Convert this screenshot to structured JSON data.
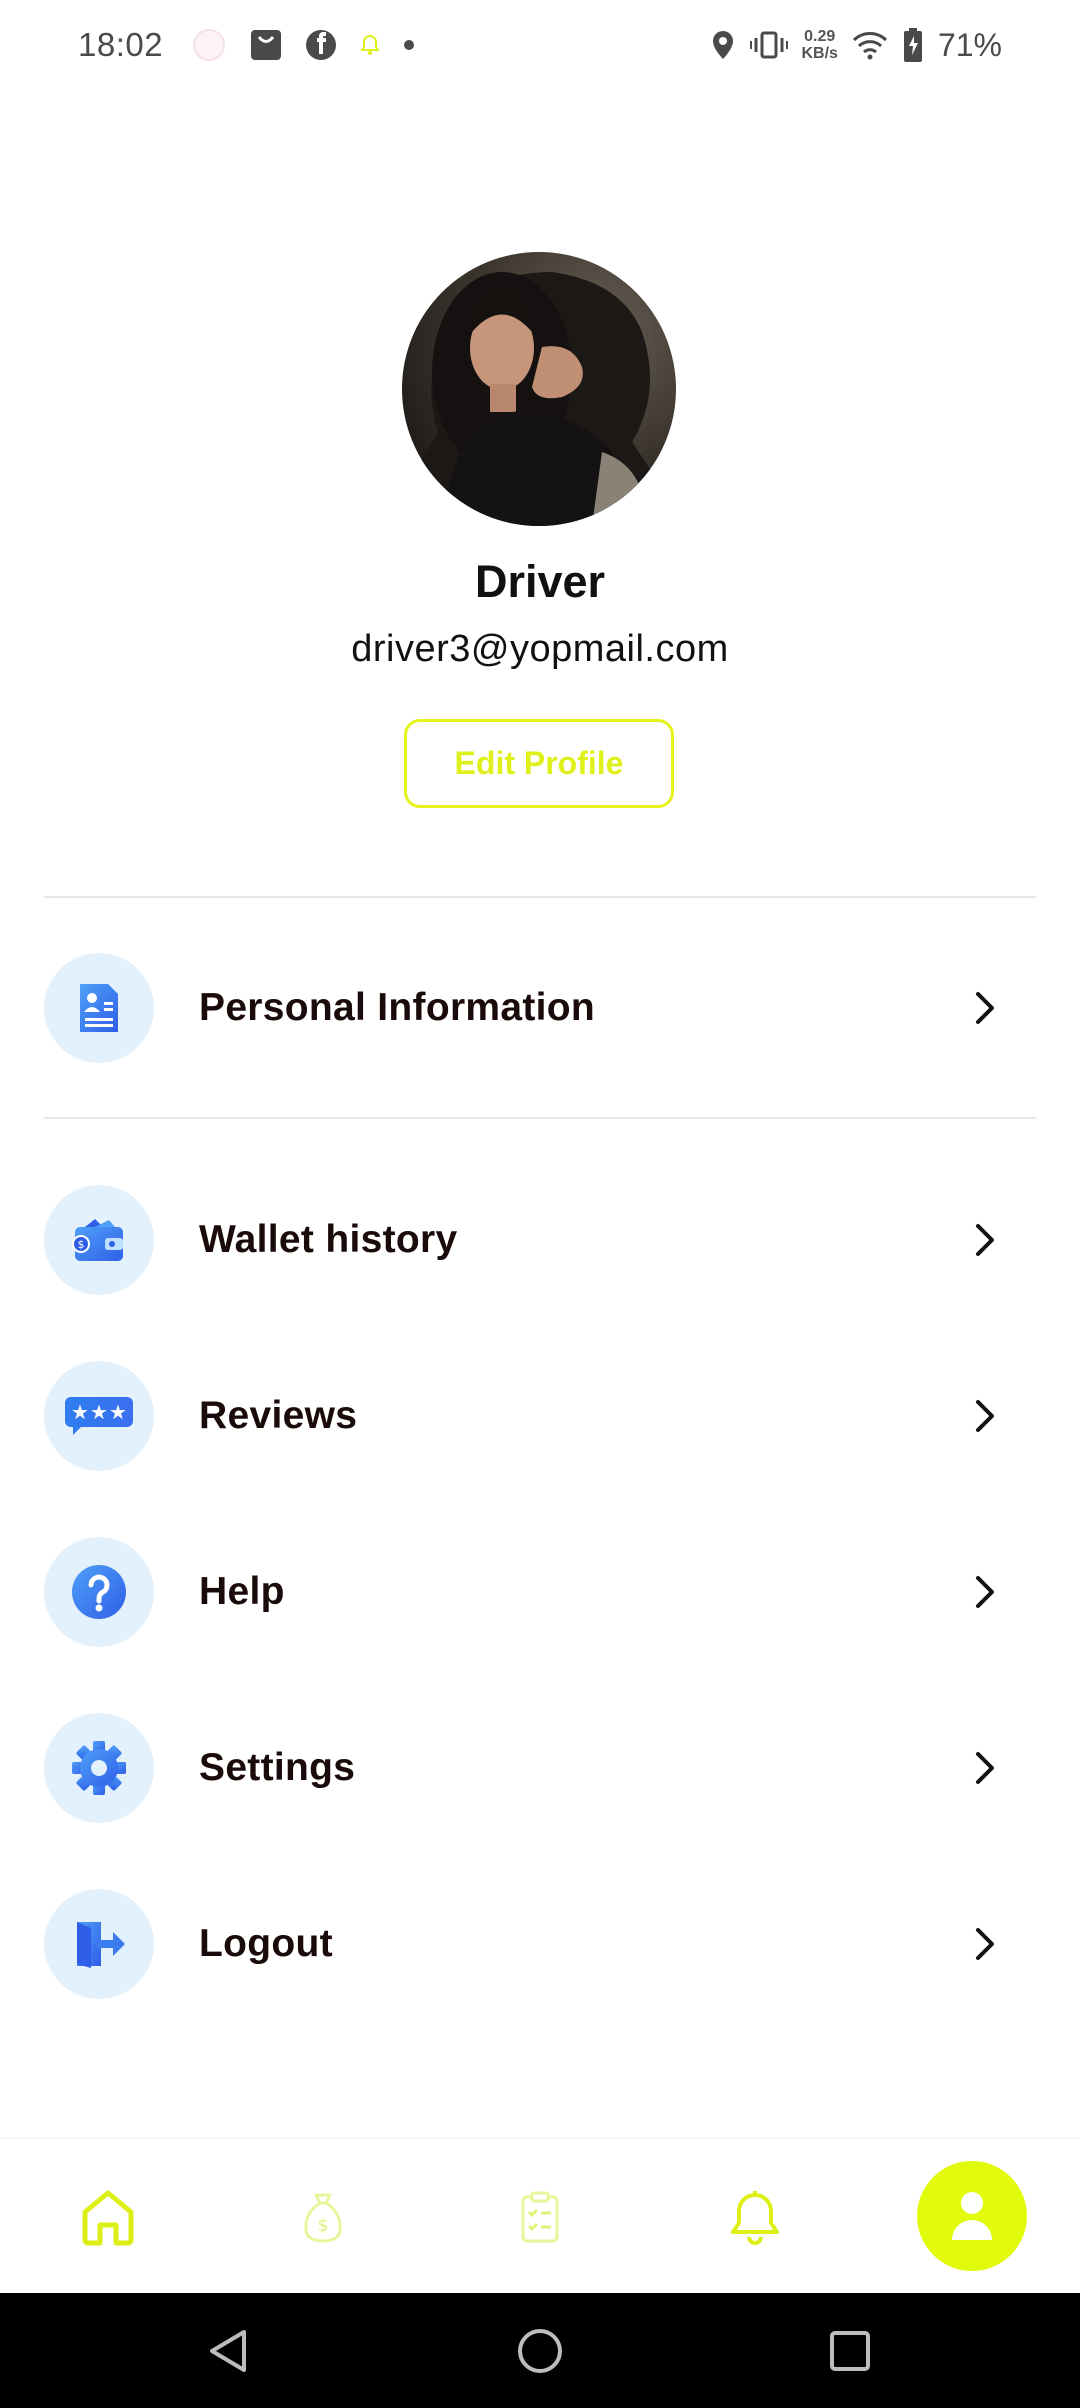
{
  "status_bar": {
    "time": "18:02",
    "net_speed_value": "0.29",
    "net_speed_unit": "KB/s",
    "battery": "71%"
  },
  "profile": {
    "name": "Driver",
    "email": "driver3@yopmail.com",
    "edit_button": "Edit Profile"
  },
  "menu": {
    "items": [
      {
        "label": "Personal Information",
        "icon": "document-user-icon"
      },
      {
        "label": "Wallet history",
        "icon": "wallet-icon"
      },
      {
        "label": "Reviews",
        "icon": "rating-stars-icon"
      },
      {
        "label": "Help",
        "icon": "question-icon"
      },
      {
        "label": "Settings",
        "icon": "gear-icon"
      },
      {
        "label": "Logout",
        "icon": "logout-icon"
      }
    ]
  },
  "bottom_nav": {
    "items": [
      "home-icon",
      "money-bag-icon",
      "clipboard-icon",
      "bell-icon",
      "user-icon"
    ],
    "active": "user-icon"
  },
  "colors": {
    "accent": "#e2fa0c",
    "icon_bg": "#e3f1fc",
    "icon_blue": "#3b7cf0"
  }
}
